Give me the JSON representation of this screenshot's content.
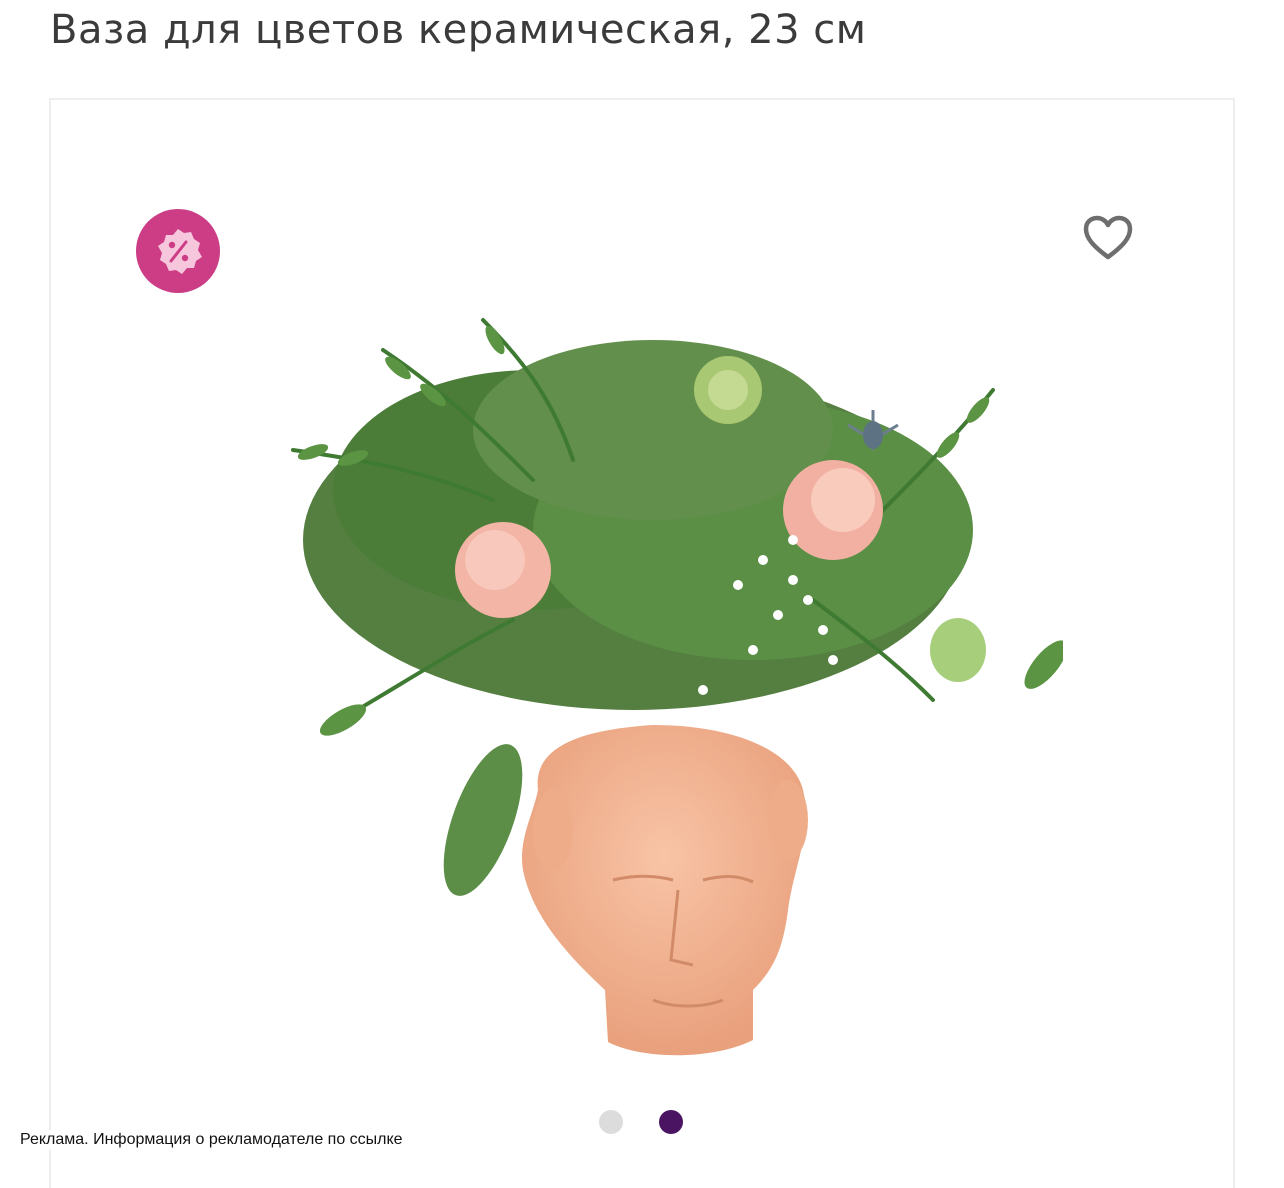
{
  "product": {
    "title": "Ваза для цветов керамическая, 23 см"
  },
  "gallery": {
    "badge_icon": "discount-percent-icon",
    "favorite_icon": "heart-outline-icon",
    "slides_total": 2,
    "active_slide": 2,
    "image_alt": "Ваза для цветов керамическая в форме головы с букетом"
  },
  "ad": {
    "notice": "Реклама. Информация о рекламодателе по ссылке"
  },
  "colors": {
    "badge": "#cc3d86",
    "dot_active": "#4a1463",
    "dot_inactive": "#dcdcdc",
    "vase": "#f3b594"
  }
}
